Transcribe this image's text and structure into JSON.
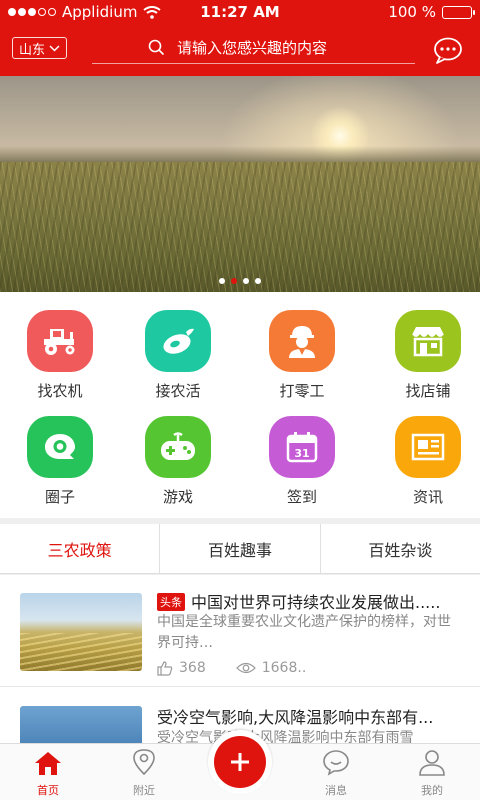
{
  "status_bar": {
    "carrier": "Applidium",
    "time": "11:27 AM",
    "battery": "100 %",
    "battery_level": 1.0
  },
  "header": {
    "region": "山东",
    "search_placeholder": "请输入您感兴趣的内容"
  },
  "banner": {
    "page_count": 4,
    "active_index": 1
  },
  "grid": [
    {
      "label": "找农机",
      "icon": "tractor-icon",
      "color": "#f05a5a"
    },
    {
      "label": "接农活",
      "icon": "eggplant-icon",
      "color": "#1ec8a0"
    },
    {
      "label": "打零工",
      "icon": "worker-icon",
      "color": "#f47a35"
    },
    {
      "label": "找店铺",
      "icon": "shop-icon",
      "color": "#9cc41e"
    },
    {
      "label": "圈子",
      "icon": "chat-bubble-icon",
      "color": "#26c35a"
    },
    {
      "label": "游戏",
      "icon": "gamepad-icon",
      "color": "#55c631"
    },
    {
      "label": "签到",
      "icon": "calendar-icon",
      "color": "#c65bd6"
    },
    {
      "label": "资讯",
      "icon": "newspaper-icon",
      "color": "#f9a70a"
    }
  ],
  "tabs": [
    {
      "label": "三农政策",
      "active": true
    },
    {
      "label": "百姓趣事",
      "active": false
    },
    {
      "label": "百姓杂谈",
      "active": false
    }
  ],
  "news": [
    {
      "tag": "头条",
      "title": "中国对世界可持续农业发展做出.....",
      "summary": "中国是全球重要农业文化遗产保护的榜样，对世界可持…",
      "likes": "368",
      "views": "1668.."
    },
    {
      "tag": "",
      "title": "受冷空气影响,大风降温影响中东部有...",
      "summary": "受冷空气影响,大风降温影响中东部有雨雪"
    }
  ],
  "bottom_nav": [
    {
      "label": "首页",
      "icon": "home-icon",
      "active": true
    },
    {
      "label": "附近",
      "icon": "location-pin-icon",
      "active": false
    },
    {
      "label": "",
      "icon": "plus-icon",
      "active": false
    },
    {
      "label": "消息",
      "icon": "message-bubble-icon",
      "active": false
    },
    {
      "label": "我的",
      "icon": "user-icon",
      "active": false
    }
  ],
  "colors": {
    "brand_red": "#e0140e"
  }
}
